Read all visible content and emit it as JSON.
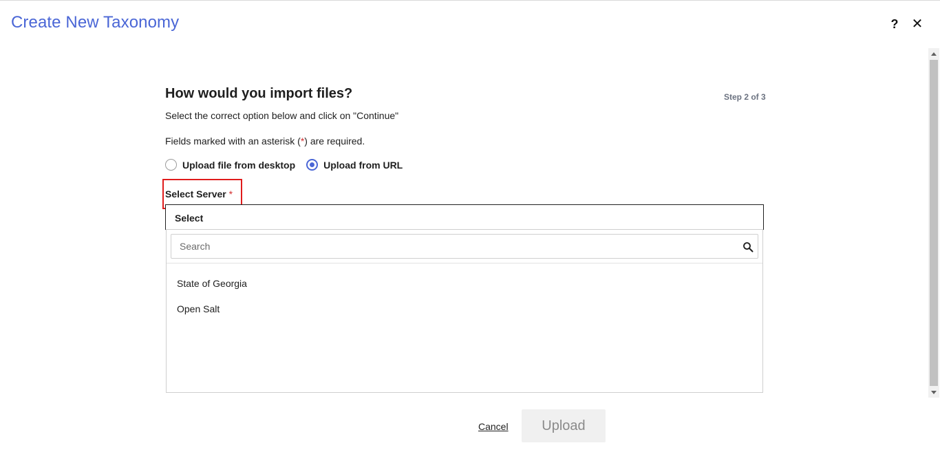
{
  "modal": {
    "title": "Create New Taxonomy",
    "help_label": "?",
    "close_label": "✕"
  },
  "form": {
    "heading": "How would you import files?",
    "step": "Step 2 of 3",
    "instruction": "Select the correct option below and click on \"Continue\"",
    "required_note_prefix": "Fields marked with an asterisk (",
    "required_note_asterisk": "*",
    "required_note_suffix": ") are required.",
    "import_options": [
      {
        "label": "Upload file from desktop",
        "selected": false
      },
      {
        "label": "Upload from URL",
        "selected": true
      }
    ]
  },
  "server": {
    "label": "Select Server",
    "required_mark": "*",
    "selected_value": "Select",
    "search_placeholder": "Search",
    "options": [
      "State of Georgia",
      "Open Salt"
    ]
  },
  "actions": {
    "cancel_label": "Cancel",
    "upload_label": "Upload"
  },
  "colors": {
    "accent": "#4a66d6",
    "highlight_box": "#e01b1b",
    "required": "#d32f2f"
  }
}
